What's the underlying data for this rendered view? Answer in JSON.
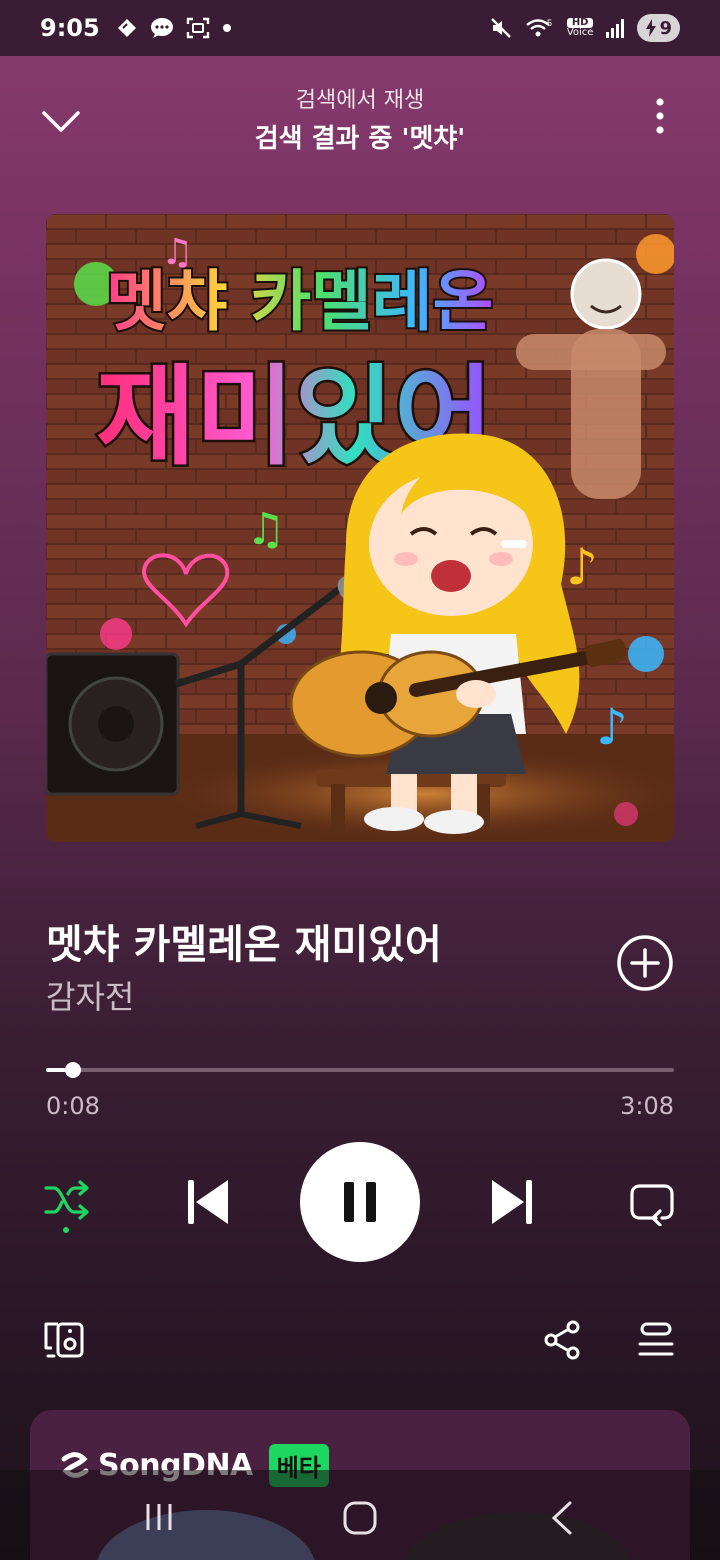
{
  "status_bar": {
    "time": "9:05",
    "battery_level": "9",
    "hd_label": "HD",
    "voice_label": "Voice",
    "network_label": "5"
  },
  "header": {
    "context_label": "검색에서 재생",
    "context_title": "검색 결과 중 '멧챠'"
  },
  "track": {
    "title": "멧챠 카멜레온 재미있어",
    "artist": "감자전",
    "artwork_text_line1": "멧챠 카멜레온",
    "artwork_text_line2": "재미있어"
  },
  "playback": {
    "elapsed": "0:08",
    "total": "3:08",
    "progress_fraction": 0.0426,
    "is_playing": true,
    "shuffle_active": true
  },
  "songdna": {
    "name": "SongDNA",
    "badge": "베타"
  },
  "colors": {
    "accent_green": "#1ed760",
    "background_top": "#8a3b6f",
    "background_bottom": "#1e121c"
  },
  "icons": {
    "collapse": "chevron-down-icon",
    "more": "more-vertical-icon",
    "add": "add-circle-icon",
    "shuffle": "shuffle-icon",
    "previous": "skip-previous-icon",
    "pause": "pause-icon",
    "next": "skip-next-icon",
    "repeat": "repeat-icon",
    "devices": "connect-device-icon",
    "share": "share-icon",
    "queue": "queue-icon"
  }
}
